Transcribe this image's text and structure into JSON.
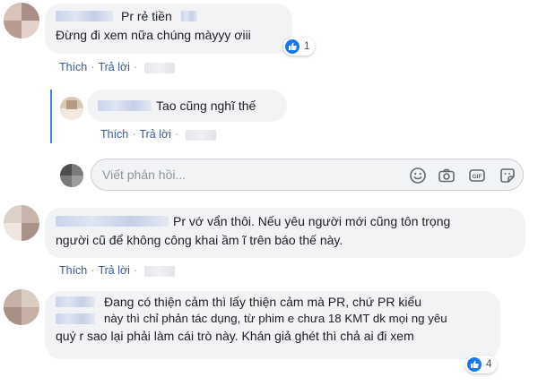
{
  "comments": [
    {
      "text_lines": [
        "Pr rẻ tiền",
        "Đừng đi xem nữa chúng màyyy ơiii"
      ],
      "reaction_count": "1",
      "actions": {
        "like": "Thích",
        "reply": "Trả lời"
      }
    },
    {
      "text_lines": [
        "Tao cũng nghĩ thế"
      ],
      "actions": {
        "like": "Thích",
        "reply": "Trả lời"
      }
    },
    {
      "text_lines": [
        "Pr vớ vẩn thôi. Nếu yêu người mới cũng tôn trọng",
        "người cũ để không công khai ầm ĩ trên báo thế này."
      ],
      "actions": {
        "like": "Thích",
        "reply": "Trả lời"
      }
    },
    {
      "text_lines": [
        "Đang có thiện cảm thì lấy thiện cảm mà PR, chứ PR kiểu",
        "này thì chỉ phản tác dụng, từ phim e chưa 18 KMT dk mọi ng yêu",
        "quý r sao lại phải làm cái trò này. Khán giả ghét thì chả ai đi xem"
      ],
      "reaction_count": "4"
    }
  ],
  "reply_input": {
    "placeholder": "Viết phản hồi..."
  },
  "input_icons": [
    "emoji-icon",
    "camera-icon",
    "gif-icon",
    "sticker-icon"
  ],
  "colors": {
    "link": "#385898",
    "like_blue": "#1877f2",
    "thread_bar": "#4080ff",
    "bubble": "#f2f3f5"
  }
}
